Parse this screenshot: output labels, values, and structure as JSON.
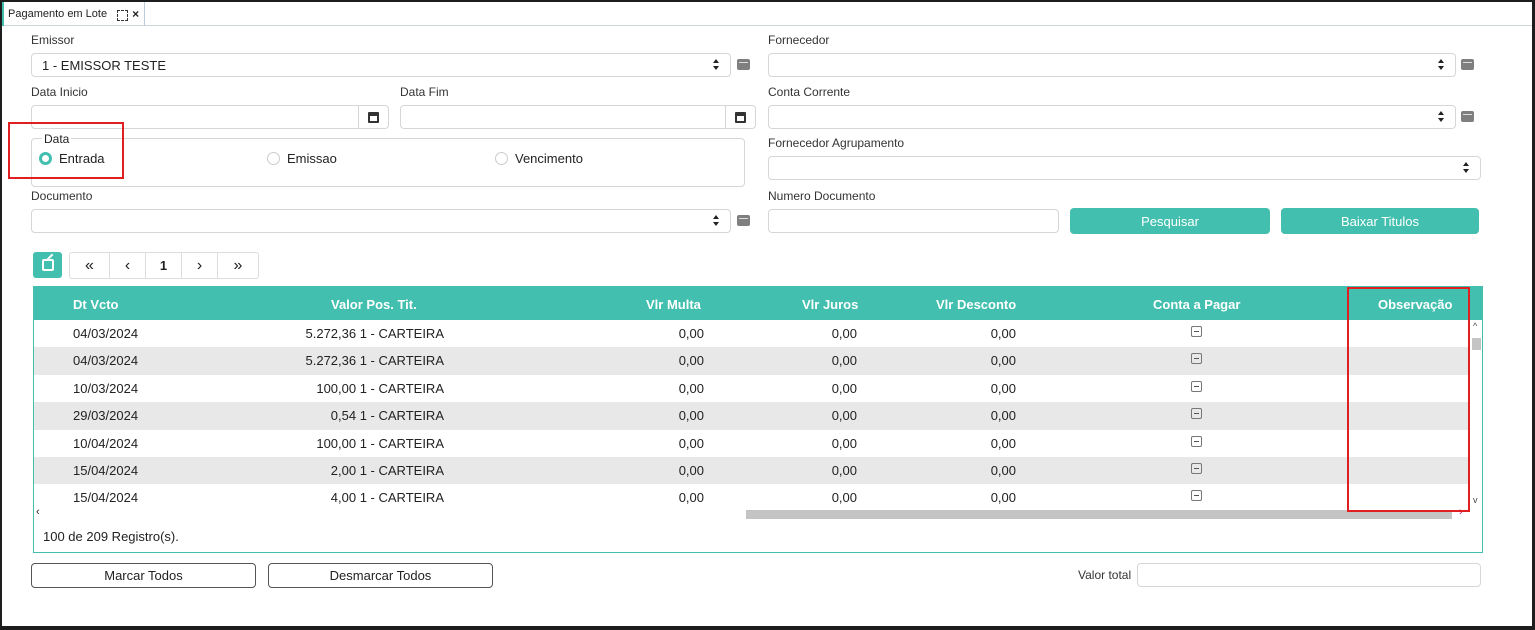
{
  "tab": {
    "title": "Pagamento em Lote"
  },
  "filters": {
    "emissor_label": "Emissor",
    "emissor_value": "1 - EMISSOR TESTE",
    "fornecedor_label": "Fornecedor",
    "fornecedor_value": "",
    "data_inicio_label": "Data Inicio",
    "data_fim_label": "Data Fim",
    "conta_corrente_label": "Conta Corrente",
    "data_legend": "Data",
    "radio_entrada": "Entrada",
    "radio_emissao": "Emissao",
    "radio_vencimento": "Vencimento",
    "selected_radio": "Entrada",
    "fornecedor_agrupamento_label": "Fornecedor Agrupamento",
    "documento_label": "Documento",
    "numero_documento_label": "Numero Documento",
    "pesquisar_label": "Pesquisar",
    "baixar_label": "Baixar Titulos"
  },
  "pager": {
    "first": "«",
    "prev": "‹",
    "page": "1",
    "next": "›",
    "last": "»"
  },
  "grid": {
    "columns": [
      "Dt Vcto",
      "Valor Pos. Tit.",
      "Vlr Multa",
      "Vlr Juros",
      "Vlr Desconto",
      "Conta a Pagar",
      "Observação"
    ],
    "rows": [
      {
        "dt": "04/03/2024",
        "valor": "5.272,36 1 - CARTEIRA",
        "multa": "0,00",
        "juros": "0,00",
        "desconto": "0,00"
      },
      {
        "dt": "04/03/2024",
        "valor": "5.272,36 1 - CARTEIRA",
        "multa": "0,00",
        "juros": "0,00",
        "desconto": "0,00"
      },
      {
        "dt": "10/03/2024",
        "valor": "100,00 1 - CARTEIRA",
        "multa": "0,00",
        "juros": "0,00",
        "desconto": "0,00"
      },
      {
        "dt": "29/03/2024",
        "valor": "0,54 1 - CARTEIRA",
        "multa": "0,00",
        "juros": "0,00",
        "desconto": "0,00"
      },
      {
        "dt": "10/04/2024",
        "valor": "100,00 1 - CARTEIRA",
        "multa": "0,00",
        "juros": "0,00",
        "desconto": "0,00"
      },
      {
        "dt": "15/04/2024",
        "valor": "2,00 1 - CARTEIRA",
        "multa": "0,00",
        "juros": "0,00",
        "desconto": "0,00"
      },
      {
        "dt": "15/04/2024",
        "valor": "4,00 1 - CARTEIRA",
        "multa": "0,00",
        "juros": "0,00",
        "desconto": "0,00"
      }
    ],
    "footer": "100 de 209 Registro(s)."
  },
  "actions": {
    "marcar_todos": "Marcar Todos",
    "desmarcar_todos": "Desmarcar Todos",
    "valor_total_label": "Valor total",
    "valor_total_value": ""
  },
  "colors": {
    "accent": "#42bfae",
    "highlight": "#e02020"
  }
}
